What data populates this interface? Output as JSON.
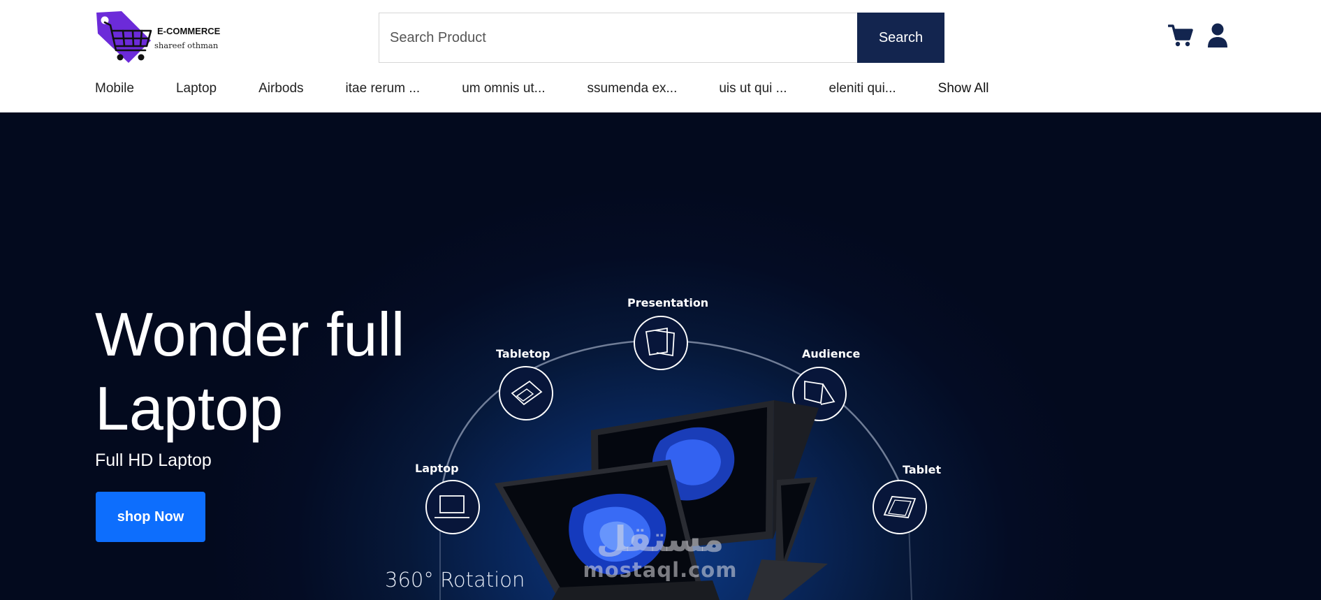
{
  "brand": {
    "title": "E-COMMERCE",
    "subtitle": "shareef othman",
    "logo_icon": "shopping-cart-tag-logo",
    "accent_color": "#6c2bd9"
  },
  "search": {
    "placeholder": "Search Product",
    "value": "",
    "button_label": "Search",
    "button_color": "#13254f"
  },
  "header_icons": [
    "cart-icon",
    "user-icon"
  ],
  "nav": {
    "items": [
      {
        "label": "Mobile"
      },
      {
        "label": "Laptop"
      },
      {
        "label": "Airbods"
      },
      {
        "label": "itae rerum ..."
      },
      {
        "label": "um omnis ut..."
      },
      {
        "label": "ssumenda ex..."
      },
      {
        "label": "uis ut qui ..."
      },
      {
        "label": "eleniti qui..."
      },
      {
        "label": "Show All"
      }
    ]
  },
  "hero": {
    "title_line1": "Wonder full",
    "title_line2": "Laptop",
    "subtitle": "Full HD Laptop",
    "cta_label": "shop Now",
    "cta_color": "#0d6efd",
    "background_color": "#040c24",
    "modes": {
      "laptop": "Laptop",
      "tabletop": "Tabletop",
      "presentation": "Presentation",
      "audience": "Audience",
      "tablet": "Tablet"
    },
    "rotation_label": "360° Rotation",
    "watermark_ar": "مستقل",
    "watermark_en": "mostaql.com"
  }
}
